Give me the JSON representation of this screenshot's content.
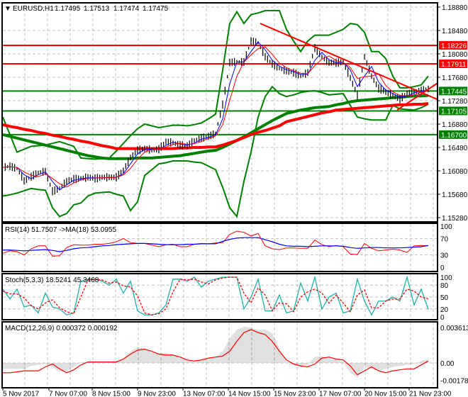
{
  "header": {
    "arrow": "▼",
    "symbol": "EURUSD,H1",
    "open": "1.17495",
    "high": "1.17513",
    "low": "1.17474",
    "close": "1.17475"
  },
  "indicators": {
    "rsi_label": "RSI(14) 51.7507  ->MA(18) 53.0955",
    "stoch_label": "Stoch(5,3,3) 18.5241 45.3468",
    "macd_label": "MACD(12,26,9) 0.000372 0.000192"
  },
  "colors": {
    "bull_line": "#008000",
    "bear_line": "#ff0000",
    "bars": "#000000",
    "rsi": "#ff0000",
    "rsi_ma": "#0000ff",
    "stoch_main": "#20b2aa",
    "stoch_signal": "#ff0000",
    "macd_hist": "#c0c0c0",
    "macd_signal": "#ff0000"
  },
  "chart_data": {
    "type": "candlestick",
    "symbol": "EURUSD",
    "timeframe": "H1",
    "x_axis": {
      "labels": [
        {
          "text": "5 Nov 2017",
          "index": 0
        },
        {
          "text": "7 Nov 07:00",
          "index": 6.5
        },
        {
          "text": "8 Nov 15:00",
          "index": 12.6
        },
        {
          "text": "9 Nov 23:00",
          "index": 19
        },
        {
          "text": "13 Nov 07:00",
          "index": 25.4
        },
        {
          "text": "14 Nov 15:00",
          "index": 31.8
        },
        {
          "text": "15 Nov 23:00",
          "index": 38.2
        },
        {
          "text": "17 Nov 07:00",
          "index": 44.6
        },
        {
          "text": "20 Nov 15:00",
          "index": 51
        },
        {
          "text": "21 Nov 23:00",
          "index": 57.3
        }
      ]
    },
    "price_axis": {
      "range": [
        1.1528,
        1.1888
      ],
      "ticks": [
        "1.18880",
        "1.18480",
        "1.18080",
        "1.17680",
        "1.17280",
        "1.16880",
        "1.16480",
        "1.16080",
        "1.15680",
        "1.15280"
      ]
    },
    "close": [
      1.1614,
      1.1616,
      1.1612,
      1.1591,
      1.1598,
      1.1605,
      1.1607,
      1.1573,
      1.1578,
      1.159,
      1.1594,
      1.1595,
      1.1597,
      1.1595,
      1.1597,
      1.1597,
      1.1597,
      1.1609,
      1.1631,
      1.1643,
      1.1646,
      1.1644,
      1.1645,
      1.1658,
      1.1656,
      1.1652,
      1.1651,
      1.166,
      1.1664,
      1.1667,
      1.1672,
      1.1721,
      1.1793,
      1.1795,
      1.1794,
      1.183,
      1.1827,
      1.1803,
      1.1791,
      1.1783,
      1.1779,
      1.1776,
      1.177,
      1.1776,
      1.1818,
      1.1803,
      1.1793,
      1.1793,
      1.1794,
      1.1767,
      1.1737,
      1.1803,
      1.177,
      1.1749,
      1.1743,
      1.1737,
      1.1731,
      1.174,
      1.1743,
      1.1745,
      1.1748
    ],
    "ma_slow_green": [
      1.167,
      1.1667,
      1.1664,
      1.1661,
      1.1658,
      1.1655,
      1.1652,
      1.1649,
      1.1646,
      1.1643,
      1.164,
      1.1637,
      1.1634,
      1.1632,
      1.163,
      1.1629,
      1.1629,
      1.1629,
      1.1629,
      1.163,
      1.163,
      1.163,
      1.1631,
      1.1632,
      1.1633,
      1.1634,
      1.1636,
      1.1638,
      1.164,
      1.1642,
      1.1643,
      1.1648,
      1.1654,
      1.166,
      1.1666,
      1.1673,
      1.168,
      1.1687,
      1.1694,
      1.17,
      1.1706,
      1.1709,
      1.1712,
      1.1714,
      1.1716,
      1.1717,
      1.1718,
      1.1721,
      1.1723,
      1.1726,
      1.1728,
      1.1729,
      1.173,
      1.1731,
      1.1732,
      1.1733,
      1.1734,
      1.1735,
      1.1736,
      1.1736,
      1.1737
    ],
    "ma_slow_red": [
      1.1687,
      1.1684,
      1.1682,
      1.1679,
      1.1677,
      1.1674,
      1.1672,
      1.1669,
      1.1667,
      1.1664,
      1.1662,
      1.1659,
      1.1657,
      1.1654,
      1.1651,
      1.1649,
      1.1646,
      1.1646,
      1.1646,
      1.1646,
      1.1646,
      1.1646,
      1.1646,
      1.1646,
      1.1646,
      1.1647,
      1.1647,
      1.1648,
      1.1648,
      1.1649,
      1.1649,
      1.1652,
      1.1656,
      1.166,
      1.1665,
      1.167,
      1.1674,
      1.1677,
      1.1681,
      1.1685,
      1.1692,
      1.1695,
      1.1698,
      1.1701,
      1.1704,
      1.1707,
      1.1709,
      1.1712,
      1.1713,
      1.1714,
      1.1715,
      1.1716,
      1.1717,
      1.1718,
      1.1719,
      1.172,
      1.1721,
      1.1721,
      1.1722,
      1.1722,
      1.1723
    ],
    "bollinger_upper": [
      1.17,
      1.167,
      1.164,
      1.1645,
      1.165,
      1.1651,
      1.1652,
      1.1655,
      1.1658,
      1.1654,
      1.165,
      1.163,
      1.1629,
      1.1628,
      1.1629,
      1.163,
      1.1642,
      1.1655,
      1.1668,
      1.168,
      1.1688,
      1.1685,
      1.1682,
      1.1684,
      1.1686,
      1.1686,
      1.1685,
      1.1687,
      1.169,
      1.1697,
      1.1705,
      1.178,
      1.186,
      1.188,
      1.186,
      1.1875,
      1.1878,
      1.1882,
      1.1882,
      1.1882,
      1.185,
      1.183,
      1.1812,
      1.183,
      1.184,
      1.184,
      1.184,
      1.1845,
      1.185,
      1.186,
      1.1858,
      1.1845,
      1.1812,
      1.1812,
      1.18,
      1.177,
      1.175,
      1.175,
      1.1752,
      1.1755,
      1.177
    ],
    "bollinger_lower": [
      1.1565,
      1.1567,
      1.157,
      1.1574,
      1.1578,
      1.1576,
      1.1575,
      1.1545,
      1.153,
      1.1535,
      1.155,
      1.1553,
      1.1565,
      1.157,
      1.1571,
      1.1572,
      1.1568,
      1.1565,
      1.154,
      1.1555,
      1.16,
      1.161,
      1.162,
      1.1622,
      1.1625,
      1.1625,
      1.1625,
      1.1623,
      1.1622,
      1.1616,
      1.161,
      1.158,
      1.1545,
      1.153,
      1.159,
      1.164,
      1.17,
      1.1735,
      1.1752,
      1.174,
      1.1735,
      1.1738,
      1.1742,
      1.1744,
      1.1745,
      1.1742,
      1.1738,
      1.1739,
      1.174,
      1.172,
      1.17,
      1.1697,
      1.1695,
      1.1695,
      1.1695,
      1.172,
      1.1714,
      1.1713,
      1.1712,
      1.1716,
      1.1722
    ],
    "horizontal_levels": [
      {
        "price": 1.18226,
        "label": "1.18226",
        "color": "#ff0000"
      },
      {
        "price": 1.17911,
        "label": "1.17911",
        "color": "#ff0000"
      },
      {
        "price": 1.17445,
        "label": "1.17445",
        "color": "#008000"
      },
      {
        "price": 1.17105,
        "label": "1.17105",
        "color": "#008000"
      },
      {
        "price": 1.167,
        "label": "1.16700",
        "color": "#008000"
      }
    ],
    "trendlines": [
      {
        "from": [
          36.3,
          1.186
        ],
        "to": [
          61.3,
          1.173
        ],
        "color": "#ff0000"
      },
      {
        "from": [
          55.6,
          1.1712
        ],
        "to": [
          61.3,
          1.1758
        ],
        "color": "#ff0000"
      }
    ],
    "rsi": {
      "range": [
        0,
        100
      ],
      "ticks": [
        "100",
        "70",
        "30",
        "0"
      ],
      "values": [
        34,
        40,
        38,
        30,
        45,
        52,
        52,
        27,
        28,
        48,
        55,
        54,
        54,
        56,
        56,
        58,
        62,
        70,
        60,
        58,
        58,
        54,
        50,
        55,
        56,
        50,
        50,
        56,
        58,
        57,
        59,
        60,
        80,
        88,
        85,
        76,
        82,
        52,
        45,
        43,
        47,
        47,
        46,
        46,
        66,
        55,
        50,
        53,
        50,
        32,
        31,
        58,
        46,
        40,
        42,
        44,
        42,
        36,
        52,
        53,
        52
      ],
      "ma": [
        42,
        42,
        41,
        40,
        41,
        42,
        43,
        41,
        38,
        41,
        45,
        47,
        48,
        50,
        52,
        53,
        55,
        56,
        57,
        58,
        58,
        57,
        56,
        55,
        55,
        55,
        56,
        56,
        57,
        57,
        57,
        63,
        68,
        71,
        72,
        72,
        72,
        67,
        62,
        56,
        52,
        51,
        51,
        50,
        51,
        52,
        52,
        52,
        51,
        48,
        46,
        47,
        48,
        48,
        47,
        47,
        47,
        48,
        49,
        50,
        53
      ]
    },
    "stochastic": {
      "range": [
        0,
        100
      ],
      "ticks": [
        "100",
        "80",
        "50",
        "20",
        "0"
      ],
      "main": [
        70,
        45,
        70,
        25,
        30,
        10,
        60,
        25,
        20,
        5,
        10,
        90,
        95,
        95,
        90,
        80,
        95,
        60,
        90,
        15,
        5,
        5,
        10,
        30,
        95,
        95,
        90,
        100,
        75,
        90,
        95,
        100,
        100,
        100,
        20,
        50,
        95,
        15,
        15,
        55,
        10,
        15,
        85,
        40,
        100,
        20,
        50,
        60,
        10,
        15,
        95,
        40,
        5,
        40,
        40,
        50,
        40,
        100,
        30,
        70,
        18.5
      ],
      "signal": [
        65,
        58,
        58,
        48,
        28,
        20,
        35,
        43,
        23,
        13,
        8,
        50,
        93,
        95,
        93,
        85,
        88,
        78,
        75,
        53,
        10,
        5,
        8,
        20,
        63,
        95,
        93,
        95,
        88,
        83,
        93,
        98,
        100,
        100,
        60,
        35,
        73,
        55,
        15,
        35,
        33,
        13,
        50,
        63,
        70,
        60,
        35,
        55,
        35,
        13,
        55,
        68,
        23,
        23,
        40,
        45,
        45,
        70,
        65,
        50,
        45.3
      ]
    },
    "macd": {
      "ticks": [
        "0.003613",
        "0.00",
        "-0.001788"
      ],
      "main": [
        -0.0006,
        -0.0006,
        -0.0006,
        -0.0006,
        -0.0003,
        -0.0002,
        -0.0001,
        -0.0004,
        -0.0009,
        -0.0008,
        -0.0004,
        0.0001,
        0.0001,
        0.0001,
        0.0001,
        0.0001,
        0.0002,
        0.0005,
        0.0012,
        0.0016,
        0.0015,
        0.0012,
        0.001,
        0.001,
        0.0009,
        0.0005,
        0.0002,
        0.0002,
        0.0004,
        0.0005,
        0.0006,
        0.0012,
        0.0025,
        0.0034,
        0.0037,
        0.0036,
        0.0033,
        0.0034,
        0.003,
        0.0015,
        0.0001,
        -0.0002,
        -0.0004,
        -0.0001,
        0.0006,
        0.0007,
        0.0004,
        0.0003,
        0.0001,
        -0.001,
        -0.0015,
        -0.0004,
        -0.0006,
        -0.0008,
        -0.0006,
        -0.0004,
        -0.0003,
        -0.0002,
        -0.0001,
        0.0002,
        0.0004
      ],
      "signal": [
        -0.001,
        -0.001,
        -0.0009,
        -0.0008,
        -0.0008,
        -0.0008,
        -0.0004,
        -0.0001,
        -0.0006,
        -0.001,
        -0.0007,
        -0.0002,
        0.0001,
        0.0001,
        0.0001,
        0.0001,
        0.0001,
        0.0004,
        0.0009,
        0.0013,
        0.0014,
        0.0012,
        0.0009,
        0.0008,
        0.0008,
        0.0006,
        0.0003,
        0.0002,
        0.0003,
        0.0005,
        0.0006,
        0.0007,
        0.0012,
        0.0022,
        0.0031,
        0.0034,
        0.0031,
        0.0029,
        0.0022,
        0.0012,
        0.0003,
        -0.0001,
        -0.0003,
        -0.0004,
        -0.0001,
        0.0005,
        0.0006,
        0.0004,
        0.0003,
        -0.0003,
        -0.0012,
        -0.0008,
        -0.0004,
        -0.0008,
        -0.001,
        -0.0008,
        -0.0007,
        -0.0006,
        -0.0006,
        -0.0002,
        0.0002
      ]
    }
  }
}
